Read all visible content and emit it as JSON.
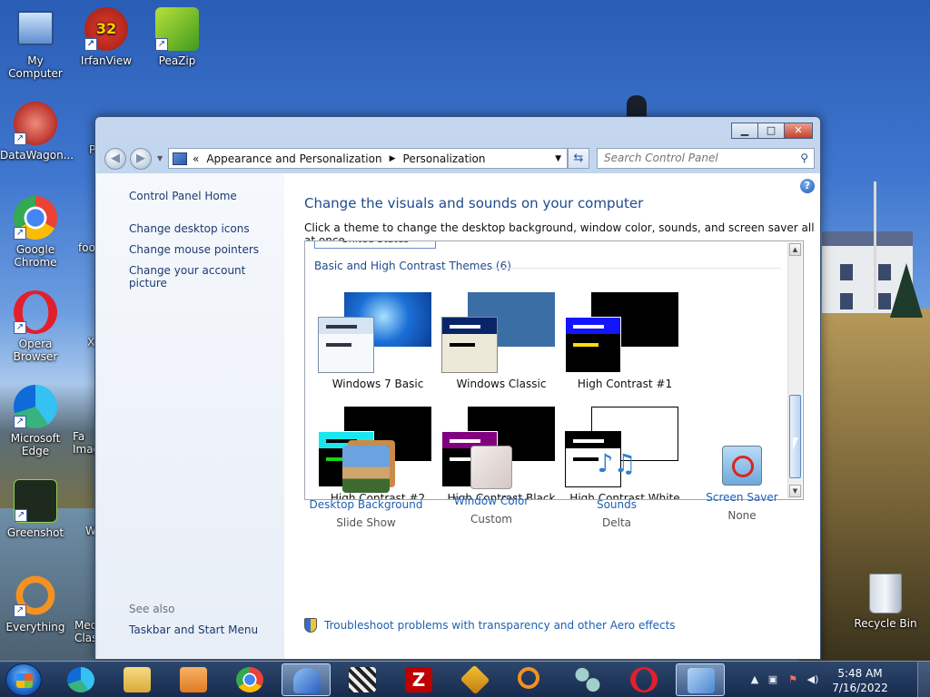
{
  "desktop": {
    "icons": [
      {
        "label": "My Computer"
      },
      {
        "label": "IrfanView"
      },
      {
        "label": "PeaZip"
      },
      {
        "label": "DataWagon..."
      },
      {
        "label": "Google Chrome"
      },
      {
        "label": "Opera Browser"
      },
      {
        "label": "Microsoft Edge"
      },
      {
        "label": "Greenshot"
      },
      {
        "label": "Everything"
      },
      {
        "label": "Recycle Bin"
      }
    ],
    "partial_icons": [
      {
        "label": "P"
      },
      {
        "label": "foo"
      },
      {
        "label": "X"
      },
      {
        "label": "Fa Imag"
      },
      {
        "label": "W"
      },
      {
        "label": "Med Clas"
      }
    ]
  },
  "window": {
    "address": {
      "chevrons": "«",
      "crumb1": "Appearance and Personalization",
      "crumb2": "Personalization"
    },
    "search": {
      "placeholder": "Search Control Panel"
    },
    "left_pane": {
      "home": "Control Panel Home",
      "links": [
        "Change desktop icons",
        "Change mouse pointers",
        "Change your account picture"
      ],
      "see_also": "See also",
      "see_also_links": [
        "Taskbar and Start Menu"
      ]
    },
    "main": {
      "title": "Change the visuals and sounds on your computer",
      "description": "Click a theme to change the desktop background, window color, sounds, and screen saver all at once.",
      "cut_item": "United States",
      "group": "Basic and High Contrast Themes (6)",
      "themes": [
        {
          "label": "Windows 7 Basic"
        },
        {
          "label": "Windows Classic"
        },
        {
          "label": "High Contrast #1"
        },
        {
          "label": "High Contrast #2"
        },
        {
          "label": "High Contrast Black"
        },
        {
          "label": "High Contrast White"
        }
      ],
      "tools": [
        {
          "name": "Desktop Background",
          "sub": "Slide Show"
        },
        {
          "name": "Window Color",
          "sub": "Custom"
        },
        {
          "name": "Sounds",
          "sub": "Delta"
        },
        {
          "name": "Screen Saver",
          "sub": "None"
        }
      ],
      "troubleshoot": "Troubleshoot problems with transparency and other Aero effects"
    }
  },
  "taskbar": {
    "clock_time": "5:48 AM",
    "clock_date": "7/16/2022",
    "apps": [
      "Microsoft Edge",
      "Windows Explorer",
      "Media Player",
      "Google Chrome",
      "Personalization",
      "MediaInfo",
      "FileZilla",
      "Winamp",
      "Search",
      "Network",
      "Opera",
      "Control Panel"
    ]
  }
}
